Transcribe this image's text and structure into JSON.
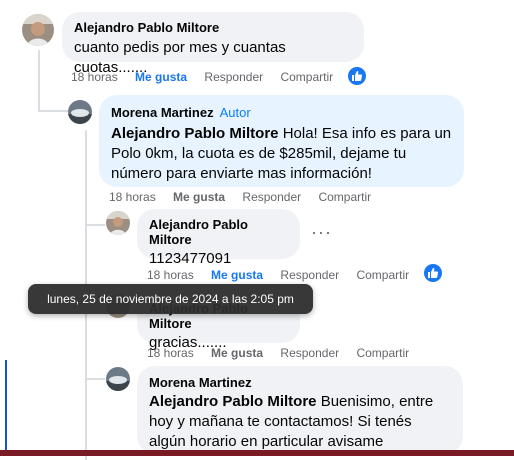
{
  "comments": [
    {
      "author": "Alejandro Pablo Miltore",
      "text": "cuanto pedis por mes y cuantas cuotas.......",
      "time": "18 horas",
      "like": "Me gusta",
      "reply": "Responder",
      "share": "Compartir"
    },
    {
      "author": "Morena Martinez",
      "badge": "Autor",
      "mention": "Alejandro Pablo Miltore",
      "text": " Hola! Esa info es para un Polo 0km, la cuota es de $285mil, dejame tu número para enviarte mas información!",
      "time": "18 horas",
      "like": "Me gusta",
      "reply": "Responder",
      "share": "Compartir"
    },
    {
      "author": "Alejandro Pablo Miltore",
      "text": "1123477091",
      "time": "18 horas",
      "like": "Me gusta",
      "reply": "Responder",
      "share": "Compartir"
    },
    {
      "author": "Alejandro Pablo Miltore",
      "text": "gracias.......",
      "time": "18 horas",
      "like": "Me gusta",
      "reply": "Responder",
      "share": "Compartir"
    },
    {
      "author": "Morena Martinez",
      "mention": "Alejandro Pablo Miltore",
      "text": " Buenisimo, entre hoy y mañana te contactamos! Si tenés algún horario en particular avisame"
    }
  ],
  "tooltip": "lunes, 25 de noviembre de 2024 a las 2:05 pm",
  "more_icon": "more-options-icon",
  "reaction_icon": "thumbs-up-icon",
  "colors": {
    "accent": "#1877f2",
    "bubble": "#f0f2f5",
    "author_bubble": "#e7f3ff"
  }
}
